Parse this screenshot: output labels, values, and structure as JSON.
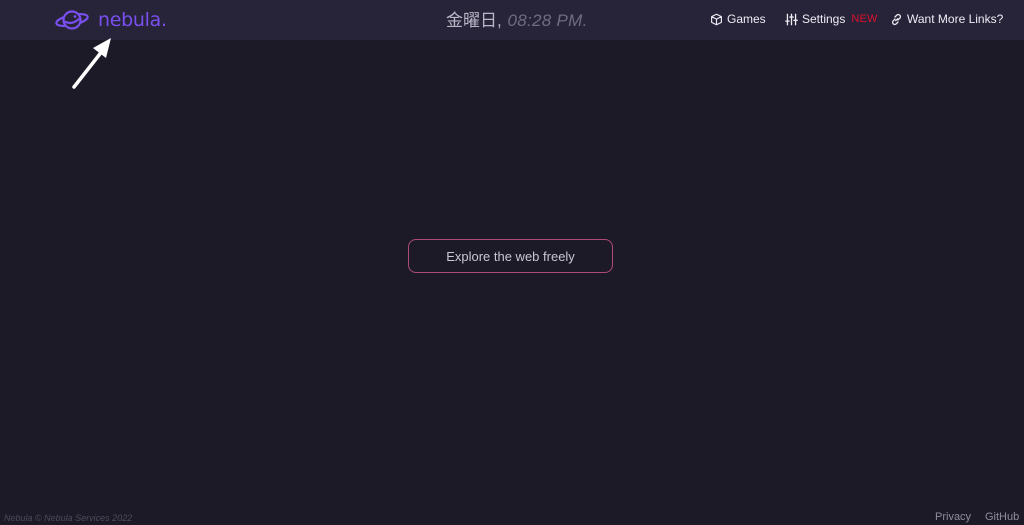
{
  "header": {
    "logo_text": "nebula.",
    "clock": {
      "day": "金曜日,",
      "time": "08:28 PM."
    },
    "nav": [
      {
        "label": "Games",
        "icon": "cube-icon"
      },
      {
        "label": "Settings",
        "icon": "sliders-icon",
        "badge": "NEW"
      },
      {
        "label": "Want More Links?",
        "icon": "link-icon"
      }
    ]
  },
  "main": {
    "button_label": "Explore the web freely"
  },
  "footer": {
    "copyright": "Nebula © Nebula Services 2022",
    "links": [
      "Privacy",
      "GitHub"
    ]
  },
  "colors": {
    "background": "#1c1a26",
    "topbar": "#27243a",
    "accent": "#7a4ff0",
    "button_border": "#b04a77",
    "badge": "#e0102c"
  }
}
